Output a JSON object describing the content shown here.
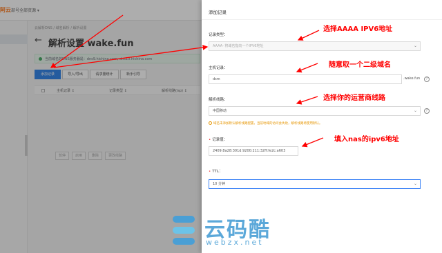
{
  "topbar": {
    "logo": "阿云",
    "account": "部号全部资源 ▾"
  },
  "breadcrumb": "云解析DNS  /  域名解析  /  解析设置",
  "page": {
    "title": "解析设置 wake.fun"
  },
  "notice": {
    "text": "当前域名的DNS服务器是：dns9.hichina.com, dns10.hichina.com"
  },
  "toolbar": {
    "add_record": "添加记录",
    "import_export": "导入/导出",
    "stats": "请求量统计",
    "guide": "新手引导"
  },
  "table": {
    "columns": [
      "主机记录 ↕",
      "记录类型 ↕",
      "解析线路(isp) ↕"
    ]
  },
  "bottom_actions": [
    "暂停",
    "启用",
    "删除",
    "更改线路"
  ],
  "drawer": {
    "title": "添加记录",
    "record_type": {
      "label": "记录类型：",
      "value": "AAAA- 将域名指向一个IPV6地址"
    },
    "host": {
      "label": "主机记录：",
      "value": "dsm",
      "suffix": ".wake.fun"
    },
    "line": {
      "label": "解析线路：",
      "value": "中国移动",
      "hint": "域名未添加默认解析线路配置，当前地域的访问会失败，解析线路将使用默认。"
    },
    "record_value": {
      "label": "记录值：",
      "value": "2409:8a28:301d:9200:211:32ff:fe2c:a603"
    },
    "ttl": {
      "label": "TTL：",
      "value": "10 分钟"
    }
  },
  "annotations": {
    "a1": "选择AAAA IPV6地址",
    "a2": "随意取一个二级域名",
    "a3": "选择你的运营商线路",
    "a4": "填入nas的ipv6地址"
  },
  "watermark": {
    "main": "云码酷",
    "sub": "webzx.net"
  },
  "colors": {
    "primary": "#1473e6",
    "annotation": "#ff0000",
    "hint": "#e69500",
    "watermark": "#4a9fd5"
  }
}
